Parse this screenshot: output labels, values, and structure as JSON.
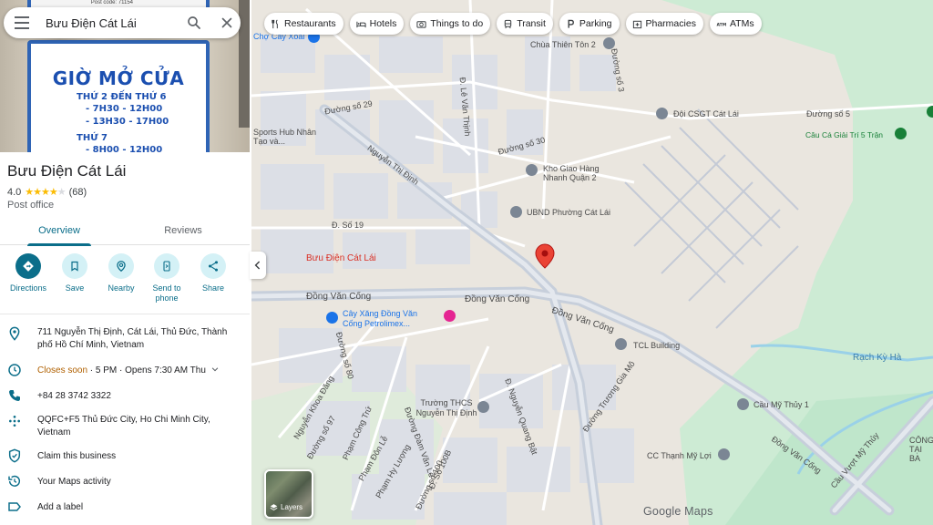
{
  "search": {
    "query": "Bưu Điện Cát Lái"
  },
  "photo_sign": {
    "title": "GIỜ MỞ CỬA",
    "lines": [
      "THỨ 2 ĐẾN THỨ 6",
      "- 7H30 - 12H00",
      "- 13H30 - 17H00",
      "THỨ 7",
      "- 8H00 - 12H00"
    ],
    "post_code": "Post code: 71154"
  },
  "place": {
    "name": "Bưu Điện Cát Lái",
    "rating": "4.0",
    "stars": "★★★★",
    "star_empty": "★",
    "reviews_count": "(68)",
    "category": "Post office"
  },
  "tabs": [
    {
      "label": "Overview",
      "active": true
    },
    {
      "label": "Reviews",
      "active": false
    }
  ],
  "actions": [
    {
      "label": "Directions",
      "icon": "directions-icon"
    },
    {
      "label": "Save",
      "icon": "bookmark-icon"
    },
    {
      "label": "Nearby",
      "icon": "nearby-icon"
    },
    {
      "label": "Send to phone",
      "icon": "phone-send-icon"
    },
    {
      "label": "Share",
      "icon": "share-icon"
    }
  ],
  "info": {
    "address": "711 Nguyễn Thị Định, Cát Lái, Thủ Đức, Thành phố Hồ Chí Minh, Vietnam",
    "hours_status": "Closes soon",
    "hours_rest": " · 5 PM · Opens 7:30 AM Thu",
    "phone": "+84 28 3742 3322",
    "plus_code": "QQFC+F5 Thủ Đức City, Ho Chi Minh City, Vietnam",
    "claim": "Claim this business",
    "maps_activity": "Your Maps activity",
    "add_label": "Add a label"
  },
  "chips": [
    {
      "label": "Restaurants",
      "icon": "restaurant-icon"
    },
    {
      "label": "Hotels",
      "icon": "hotel-icon"
    },
    {
      "label": "Things to do",
      "icon": "camera-icon"
    },
    {
      "label": "Transit",
      "icon": "transit-icon"
    },
    {
      "label": "Parking",
      "icon": "parking-icon"
    },
    {
      "label": "Pharmacies",
      "icon": "pharmacy-icon"
    },
    {
      "label": "ATMs",
      "icon": "atm-icon"
    }
  ],
  "map": {
    "layers_label": "Layers",
    "logo": "Google Maps",
    "marker_label": "Bưu Điện Cát Lái",
    "labels": {
      "cho_cay_xoai": "Chợ Cây Xoài",
      "chua_thien_ton": "Chùa Thiên Tôn 2",
      "sports_hub": "Sports Hub Nhân Tạo và...",
      "doi_csgt": "Đội CSGT Cát Lái",
      "cau_ca": "Câu Cá Giải Trí 5 Trận",
      "kho_giao_hang": "Kho Giao Hàng Nhanh Quận 2",
      "ubnd": "UBND Phường Cát Lái",
      "cay_xang": "Cây Xăng Đồng Văn Cống Petrolimex...",
      "tcl": "TCL Building",
      "rach_ky_ha": "Rạch Kỳ Hà",
      "cau_my_thuy": "Cầu Mỹ Thủy 1",
      "truong_thcs": "Trường THCS Nguyễn Thị Định",
      "cc_thanh_my_loi": "CC Thạnh Mỹ Lợi",
      "cau_vuot": "Cầu Vượt Mỹ Thủy",
      "cong_tai_ba": "CÔNG TẠI BA",
      "dong_van_cong": "Đồng Văn Cống",
      "duong_so_29": "Đường số 29",
      "duong_so_30": "Đường số 30",
      "duong_so_5": "Đường số 5",
      "duong_so_19": "Đ. Số 19",
      "nguyen_thi_dinh": "Nguyễn Thị Định",
      "le_van_thinh": "Đ. Lê Văn Thịnh",
      "duong_truong_gia_mo": "Đường Trương Gia Mô",
      "nguyen_khoa_dang": "Nguyễn Khoa Đăng",
      "duong_dam_van_le": "Đường Đàm Văn Lễ",
      "pham_don_le": "Phạm Đôn Lễ",
      "nguyen_quang_bat": "Đ. Nguyễn Quang Bật",
      "duong_so_80": "Đường số 80",
      "duong_so_97": "Đường số 97",
      "pham_cong_tru": "Phạm Công Trứ",
      "pham_hy_luong": "Phạm Hy Lượng",
      "duong_so_100": "Đường số 100",
      "duong_so_100b": "Đ. Số 100B",
      "le_duc_tho_st": "Đường số 3"
    }
  }
}
